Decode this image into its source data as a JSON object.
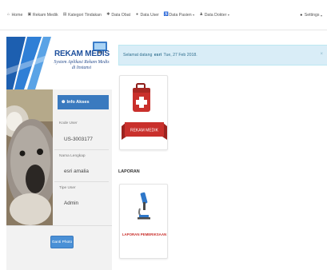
{
  "navbar": {
    "items": [
      {
        "label": "Home",
        "icon": "home-icon"
      },
      {
        "label": "Rekam Medik",
        "icon": "medkit-icon"
      },
      {
        "label": "Kategori Tindakan",
        "icon": "tags-icon"
      },
      {
        "label": "Data Obat",
        "icon": "pill-icon"
      },
      {
        "label": "Data User",
        "icon": "user-icon"
      },
      {
        "label": "Data Pasien",
        "icon": "patients-icon",
        "dropdown": true
      },
      {
        "label": "Data Dokter",
        "icon": "doctor-icon",
        "dropdown": true
      }
    ],
    "settings_label": "Settings"
  },
  "sidebar": {
    "banner_title": "REKAM MEDIS",
    "banner_subtitle_line1": "System Aplikasi Rekam Medis",
    "banner_subtitle_line2": "di Instansi",
    "info_title": "Info Akses",
    "kode_user_label": "Kode User",
    "kode_user_value": "US-3003177",
    "nama_label": "Nama Lengkap",
    "nama_value": "esri amalia",
    "tipe_label": "Tipe User",
    "tipe_value": "Admin",
    "ganti_foto_label": "Ganti Photo"
  },
  "alert": {
    "prefix": "Selamat datang",
    "user": "esri",
    "suffix": "Tue, 27 Feb 2018."
  },
  "cards": {
    "rekam_medik_label": "REKAM MEDIK",
    "laporan_section": "LAPORAN",
    "laporan_label": "LAPORAN PEMERIKSAAN"
  },
  "colors": {
    "accent": "#3a7abf",
    "alert_bg": "#d9edf7",
    "medkit_red": "#c9302c"
  }
}
